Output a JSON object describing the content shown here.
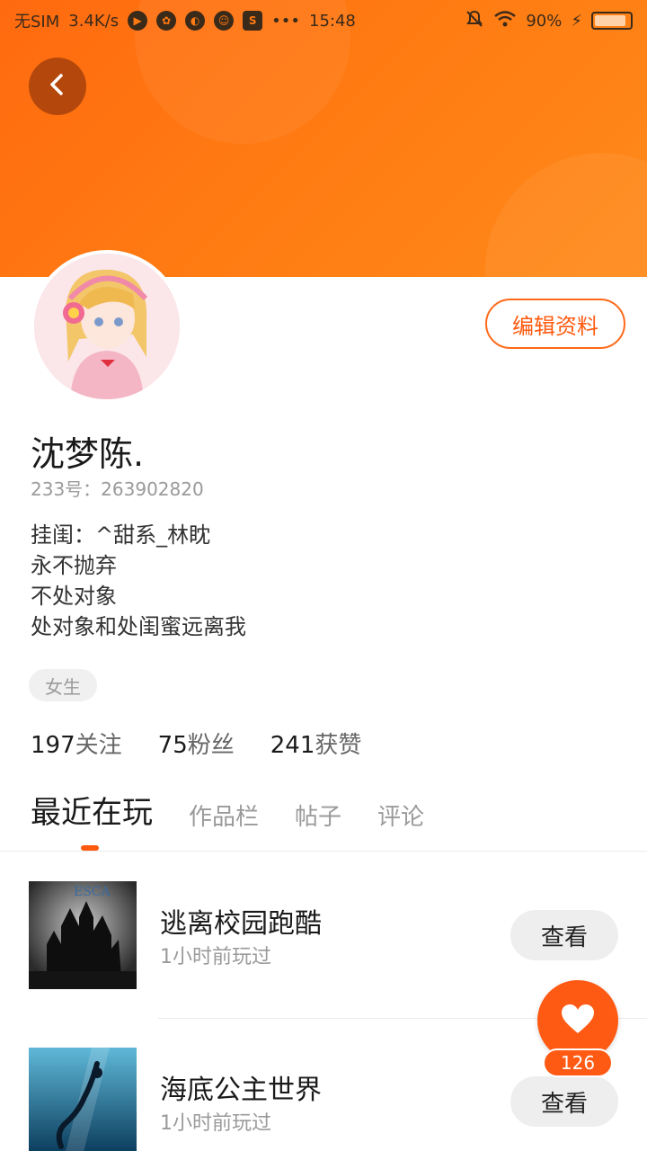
{
  "status_bar": {
    "carrier": "无SIM",
    "speed": "3.4K/s",
    "time": "15:48",
    "more": "•••",
    "battery": "90%"
  },
  "profile": {
    "username": "沈梦陈.",
    "uid": "233号：263902820",
    "bio": [
      "挂闺：^甜系_林眈",
      "永不抛弃",
      "不处对象",
      "处对象和处闺蜜远离我"
    ],
    "gender_tag": "女生",
    "edit_button": "编辑资料"
  },
  "stats": [
    {
      "num": "197",
      "label": "关注"
    },
    {
      "num": "75",
      "label": "粉丝"
    },
    {
      "num": "241",
      "label": "获赞"
    }
  ],
  "tabs": [
    {
      "label": "最近在玩",
      "active": true
    },
    {
      "label": "作品栏",
      "active": false
    },
    {
      "label": "帖子",
      "active": false
    },
    {
      "label": "评论",
      "active": false
    }
  ],
  "games": [
    {
      "title": "逃离校园跑酷",
      "subtitle": "1小时前玩过",
      "button": "查看",
      "thumb_text": "ESCA"
    },
    {
      "title": "海底公主世界",
      "subtitle": "1小时前玩过",
      "button": "查看"
    }
  ],
  "fab": {
    "count": "126"
  },
  "colors": {
    "accent": "#ff5a10",
    "header": "#ff7a12"
  },
  "icons": {
    "back": "chevron-left-icon",
    "like": "heart-icon"
  }
}
